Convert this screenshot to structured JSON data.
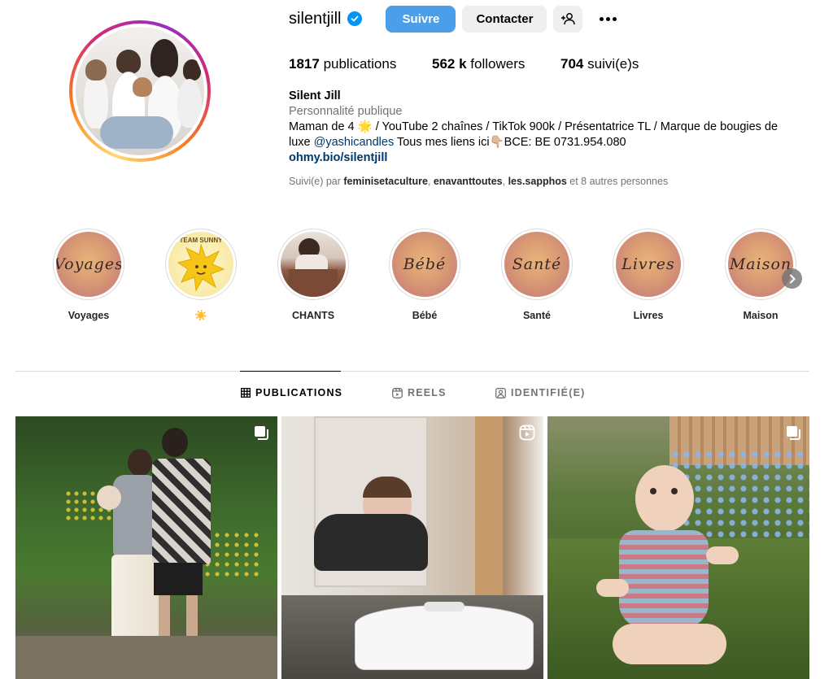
{
  "profile": {
    "username": "silentjill",
    "verified": true,
    "follow_label": "Suivre",
    "contact_label": "Contacter",
    "stats": {
      "posts_count": "1817",
      "posts_label": "publications",
      "followers_count": "562 k",
      "followers_label": "followers",
      "following_count": "704",
      "following_label": "suivi(e)s"
    },
    "bio": {
      "name": "Silent Jill",
      "category": "Personnalité publique",
      "line1": "Maman de 4 🌟 / YouTube 2 chaînes / TikTok 900k / Présentatrice TL / Marque de bougies de",
      "line2_pre": "luxe ",
      "mention": "@yashicandles",
      "line2_post": " Tous mes liens ici👇🏼BCE: BE 0731.954.080",
      "link": "ohmy.bio/silentjill"
    },
    "followed_by": {
      "prefix": "Suivi(e) par ",
      "user1": "feminisetaculture",
      "sep1": ", ",
      "user2": "enavanttoutes",
      "sep2": ", ",
      "user3": "les.sapphos",
      "suffix": " et 8 autres personnes"
    }
  },
  "highlights": [
    {
      "label": "Voyages",
      "cover_text": "Voyages"
    },
    {
      "label": "☀️",
      "cover_text": "TEAM SUNNY"
    },
    {
      "label": "CHANTS",
      "cover_text": ""
    },
    {
      "label": "Bébé",
      "cover_text": "Bébé"
    },
    {
      "label": "Santé",
      "cover_text": "Santé"
    },
    {
      "label": "Livres",
      "cover_text": "Livres"
    },
    {
      "label": "Maison",
      "cover_text": "Maison"
    }
  ],
  "tabs": [
    {
      "label": "PUBLICATIONS",
      "icon": "grid-icon",
      "active": true
    },
    {
      "label": "REELS",
      "icon": "reels-icon",
      "active": false
    },
    {
      "label": "IDENTIFIÉ(E)",
      "icon": "tagged-icon",
      "active": false
    }
  ],
  "posts": [
    {
      "type": "carousel",
      "icon": "carousel-icon",
      "description": "family photo outdoors"
    },
    {
      "type": "reel",
      "icon": "reels-icon",
      "description": "woman crawling behind robot vacuum"
    },
    {
      "type": "carousel",
      "icon": "carousel-icon",
      "description": "baby sitting in garden"
    }
  ],
  "colors": {
    "accent": "#0095f6",
    "follow_button": "#4a9fe8",
    "secondary_button": "#efefef",
    "link": "#00376b",
    "muted": "#737373"
  }
}
